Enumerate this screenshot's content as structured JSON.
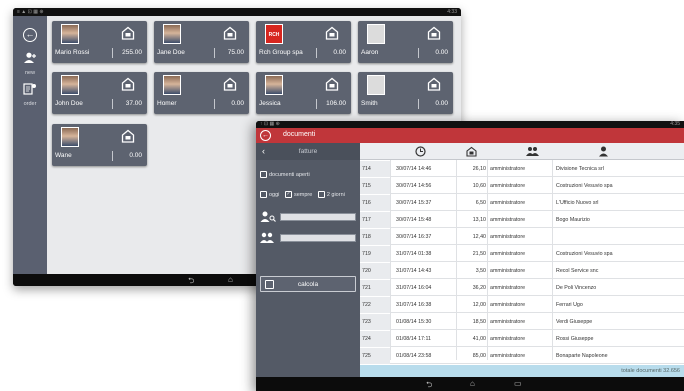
{
  "back_tablet": {
    "status_bar": {
      "left_icons": "≡ ▲ ⊡ ▦ ⊕",
      "clock": "4:33"
    },
    "rail": {
      "back_icon": "arrow-left-circle-icon",
      "new_label": "new",
      "order_label": "order"
    },
    "customers": [
      {
        "name": "Mario Rossi",
        "amount": "255.00",
        "avatar": "photo"
      },
      {
        "name": "Jane Doe",
        "amount": "75.00",
        "avatar": "photo"
      },
      {
        "name": "Rch Group spa",
        "amount": "0.00",
        "avatar": "brand",
        "avatar_text": "RCH"
      },
      {
        "name": "Aaron",
        "amount": "0.00",
        "avatar": "blank"
      },
      {
        "name": "John Doe",
        "amount": "37.00",
        "avatar": "photo"
      },
      {
        "name": "Homer",
        "amount": "0.00",
        "avatar": "photo"
      },
      {
        "name": "Jessica",
        "amount": "106.00",
        "avatar": "photo"
      },
      {
        "name": "Smith",
        "amount": "0.00",
        "avatar": "blank"
      },
      {
        "name": "Wane",
        "amount": "0.00",
        "avatar": "photo"
      }
    ]
  },
  "front_tablet": {
    "status_bar": {
      "left_icons": "↑ ⊡ ▦ ⊕",
      "clock": "4:35"
    },
    "app_title": "documenti",
    "sidebar": {
      "header": "fatture",
      "open_docs_label": "documenti aperti",
      "filter_today": "oggi",
      "filter_always": "sempre",
      "filter_days": "2 giorni",
      "calc_label": "calcola"
    },
    "columns": [
      "number-icon",
      "clock-icon",
      "building-icon",
      "operator-icon",
      "customer-icon"
    ],
    "rows": [
      {
        "num": "714",
        "date": "30/07/14 14:46",
        "amount": "26,10",
        "user": "amministratore",
        "customer": "Divisione Tecnica srl"
      },
      {
        "num": "715",
        "date": "30/07/14 14:56",
        "amount": "10,60",
        "user": "amministratore",
        "customer": "Costruzioni Vesuvio spa"
      },
      {
        "num": "716",
        "date": "30/07/14 15:37",
        "amount": "6,50",
        "user": "amministratore",
        "customer": "L'Ufficio Nuovo srl"
      },
      {
        "num": "717",
        "date": "30/07/14 15:48",
        "amount": "13,10",
        "user": "amministratore",
        "customer": "Bogo Maurizio"
      },
      {
        "num": "718",
        "date": "30/07/14 16:37",
        "amount": "12,40",
        "user": "amministratore",
        "customer": ""
      },
      {
        "num": "719",
        "date": "31/07/14 01:38",
        "amount": "21,50",
        "user": "amministratore",
        "customer": "Costruzioni Vesuvio spa"
      },
      {
        "num": "720",
        "date": "31/07/14 14:43",
        "amount": "3,50",
        "user": "amministratore",
        "customer": "Recol Service snc"
      },
      {
        "num": "721",
        "date": "31/07/14 16:04",
        "amount": "36,20",
        "user": "amministratore",
        "customer": "De Poli Vincenzo"
      },
      {
        "num": "722",
        "date": "31/07/14 16:38",
        "amount": "12,00",
        "user": "amministratore",
        "customer": "Ferrari Ugo"
      },
      {
        "num": "723",
        "date": "01/08/14 15:30",
        "amount": "18,50",
        "user": "amministratore",
        "customer": "Verdi Giuseppe"
      },
      {
        "num": "724",
        "date": "01/08/14 17:11",
        "amount": "41,00",
        "user": "amministratore",
        "customer": "Rossi Giuseppe"
      },
      {
        "num": "725",
        "date": "01/08/14 23:58",
        "amount": "85,00",
        "user": "amministratore",
        "customer": "Bonaparte Napoleone"
      }
    ],
    "footer_total": "totale documenti 32.656"
  },
  "colors": {
    "accent_red": "#c0363a",
    "tile": "#5d6370",
    "rail": "#5a6070",
    "footer": "#b8dcec"
  }
}
